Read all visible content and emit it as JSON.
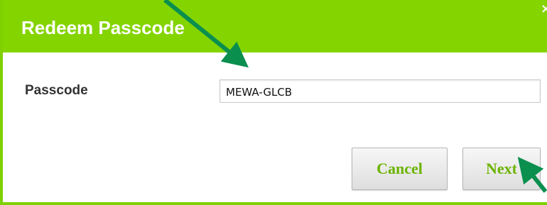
{
  "dialog": {
    "title": "Redeem Passcode",
    "close_glyph": "×"
  },
  "form": {
    "passcode_label": "Passcode",
    "passcode_value": "MEWA-GLCB"
  },
  "buttons": {
    "cancel_label": "Cancel",
    "next_label": "Next"
  },
  "colors": {
    "header_green": "#84d400",
    "button_text_green": "#6cb400",
    "arrow_green": "#0b8f4f"
  },
  "icons": {
    "close": "close-icon"
  }
}
